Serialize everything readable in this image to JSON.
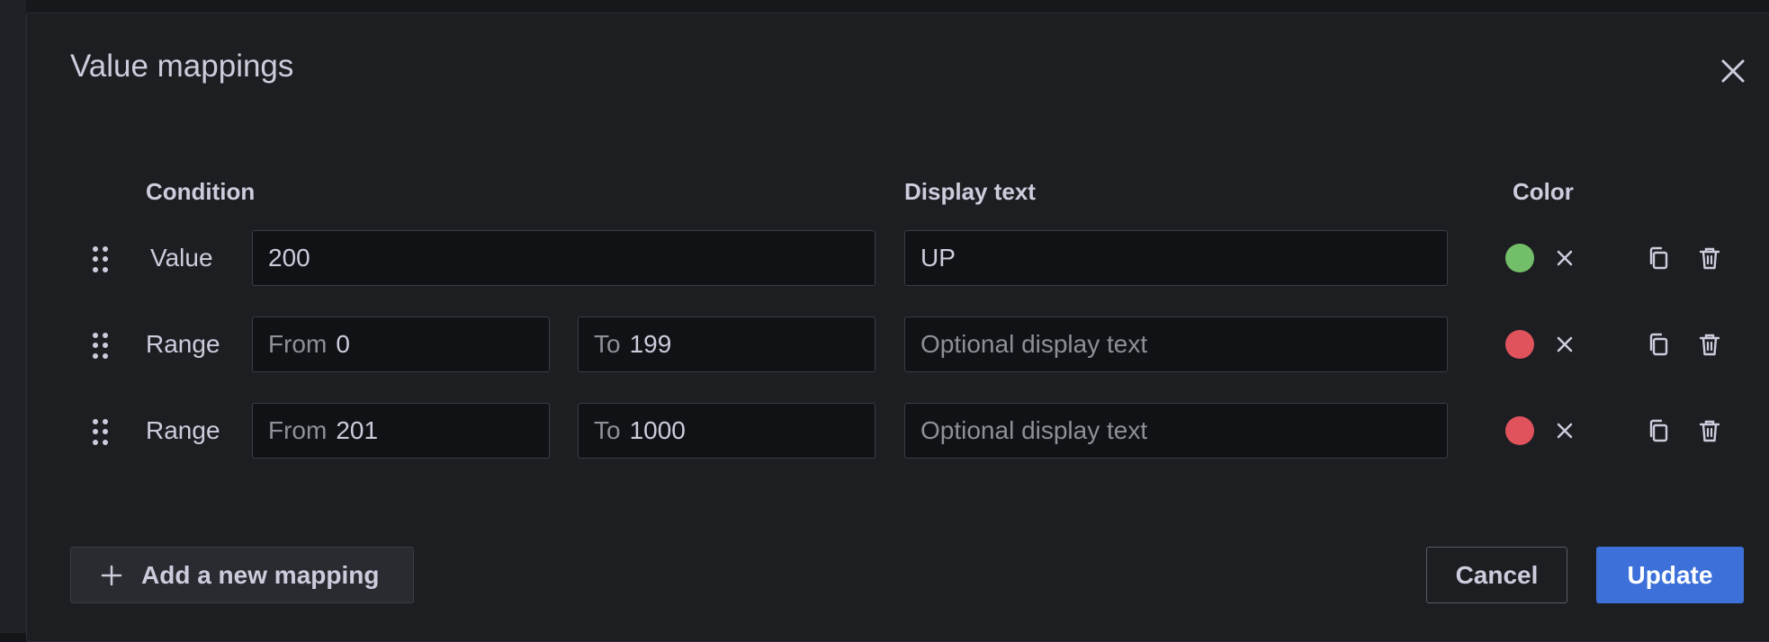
{
  "dialog": {
    "title": "Value mappings"
  },
  "headers": {
    "condition": "Condition",
    "display_text": "Display text",
    "color": "Color"
  },
  "rows": [
    {
      "type": "Value",
      "value": "200",
      "display_text": "UP",
      "color": "#73bf69"
    },
    {
      "type": "Range",
      "from_prefix": "From",
      "from": "0",
      "to_prefix": "To",
      "to": "199",
      "display_placeholder": "Optional display text",
      "color": "#e0525c"
    },
    {
      "type": "Range",
      "from_prefix": "From",
      "from": "201",
      "to_prefix": "To",
      "to": "1000",
      "display_placeholder": "Optional display text",
      "color": "#e0525c"
    }
  ],
  "footer": {
    "add_label": "Add a new mapping",
    "cancel_label": "Cancel",
    "update_label": "Update"
  },
  "icons": {
    "close": "close-icon",
    "drag": "drag-handle-icon",
    "clear": "clear-color-icon",
    "copy": "copy-icon",
    "delete": "trash-icon",
    "add": "plus-icon"
  },
  "colors": {
    "accent": "#3d71d9",
    "green": "#73bf69",
    "red": "#e0525c"
  }
}
